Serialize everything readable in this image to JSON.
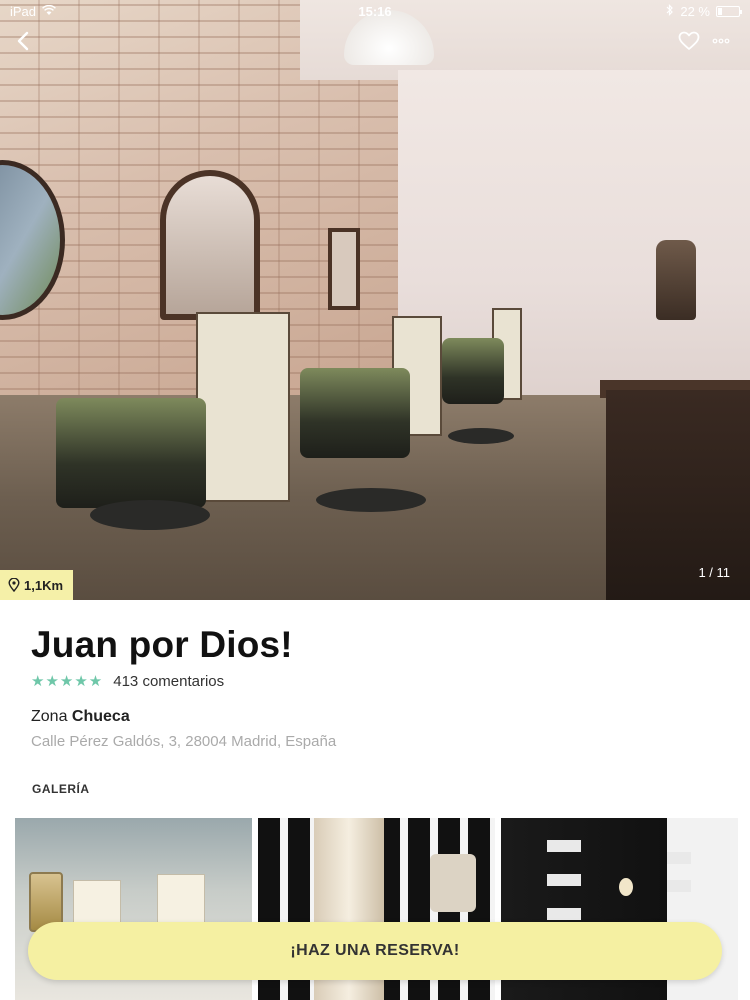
{
  "status_bar": {
    "device": "iPad",
    "time": "15:16",
    "battery": "22 %",
    "battery_level": 0.22
  },
  "nav": {
    "back_icon": "chevron-left-icon",
    "favorite_icon": "heart-icon",
    "more_icon": "more-dots-icon"
  },
  "hero": {
    "distance": "1,1Km",
    "distance_icon": "location-pin-icon",
    "photo_counter": "1 / 11"
  },
  "venue": {
    "name": "Juan por Dios!",
    "rating_stars": "★★★★★",
    "rating": 5,
    "comments": "413 comentarios",
    "zone_prefix": "Zona",
    "zone_name": "Chueca",
    "address": "Calle Pérez Galdós, 3, 28004 Madrid, España"
  },
  "gallery": {
    "label": "GALERÍA"
  },
  "cta": {
    "label": "¡HAZ UNA RESERVA!"
  },
  "colors": {
    "accent_yellow": "#f5f0a2",
    "stars_green": "#6fc7a9",
    "address_gray": "#aaaaaa"
  }
}
